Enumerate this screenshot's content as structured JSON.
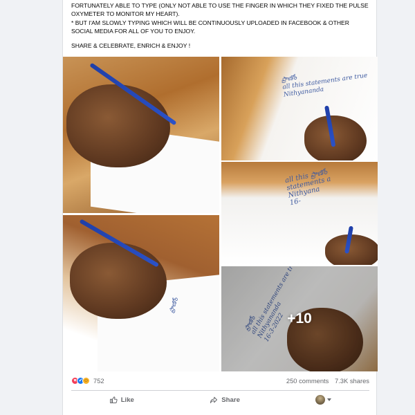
{
  "post": {
    "lines": [
      "FORTUNATELY ABLE TO TYPE (ONLY NOT ABLE TO USE THE FINGER IN WHICH THEY FIXED THE PULSE OXYMETER TO MONITOR MY HEART).",
      "* BUT I'AM SLOWLY TYPING WHICH WILL BE CONTINUOUSLY UPLOADED IN FACEBOOK & OTHER SOCIAL MEDIA FOR ALL OF YOU TO ENJOY.",
      "SHARE & CELEBRATE, ENRICH & ENJOY !"
    ]
  },
  "gallery": {
    "photo_2_note": "ప్రాణోం\nall this statements are true\nNithyananda",
    "photo_3_note": "all this ప్రాణోం\nstatements a\nNithyana\n16-",
    "photo_4_note": "ప్రాణోం",
    "photo_5_note": "ప్రాణోం\nall this statements are true\nNithyananda\n16-3-2022",
    "more_count": "+10"
  },
  "stats": {
    "reaction_count": "752",
    "comments": "250 comments",
    "shares": "7.3K shares"
  },
  "actions": {
    "like": "Like",
    "share": "Share"
  },
  "colors": {
    "background": "#f0f2f5",
    "card": "#ffffff",
    "secondary_text": "#65676b",
    "like_blue": "#1877f2",
    "love_red": "#f33e58"
  },
  "icons": [
    "like-reaction-icon",
    "love-reaction-icon",
    "care-reaction-icon",
    "thumbs-up-icon",
    "share-arrow-icon",
    "caret-down-icon"
  ]
}
